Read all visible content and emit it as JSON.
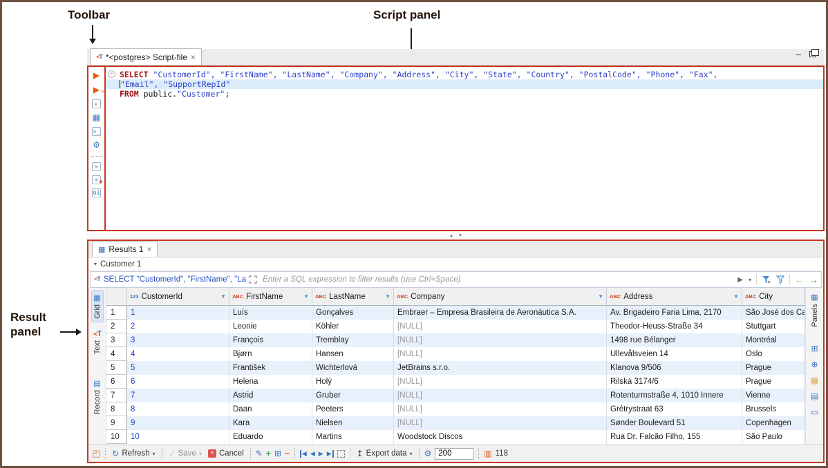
{
  "annotations": {
    "toolbar": "Toolbar",
    "script_panel": "Script panel",
    "result_panel": "Result panel"
  },
  "icons": {
    "caret_down": "▾",
    "sort_down": "▼",
    "refresh": "↻",
    "save_check": "✓",
    "cancel_x": "×",
    "export_up": "↥",
    "gear": "⚙",
    "nav_prev": "◀",
    "nav_next": "▶",
    "grid_tab": "▦",
    "record_tab": "▤",
    "panels_tab": "▦",
    "results_tab": "▦",
    "breadcrumb_caret": "▾",
    "filter_play": "▶",
    "hist_back": "←",
    "hist_fwd": "→",
    "edit_cell": "✎",
    "add_row": "+",
    "dup_row": "⊞",
    "del_row": "−",
    "row_count_glyph": "▥",
    "presentation": "◰",
    "minimize": "–",
    "sash_up": "▲",
    "sash_down": "▼",
    "fold": "−"
  },
  "editor": {
    "tab_title": "*<postgres> Script-file",
    "close": "×",
    "fold_marker": "−",
    "lines": [
      {
        "highlight": false,
        "cursor": false,
        "tokens": [
          {
            "c": "kw",
            "t": "SELECT"
          },
          {
            "c": "pl",
            "t": " "
          },
          {
            "c": "id",
            "t": "\"CustomerId\", \"FirstName\", \"LastName\", \"Company\", \"Address\", \"City\", \"State\", \"Country\", \"PostalCode\", \"Phone\", \"Fax\","
          }
        ]
      },
      {
        "highlight": true,
        "cursor": true,
        "tokens": [
          {
            "c": "id",
            "t": "\"Email\", \"SupportRepId\""
          }
        ]
      },
      {
        "highlight": false,
        "cursor": false,
        "tokens": [
          {
            "c": "kw",
            "t": "FROM"
          },
          {
            "c": "pl",
            "t": " public."
          },
          {
            "c": "id",
            "t": "\"Customer\""
          },
          {
            "c": "pl",
            "t": ";"
          }
        ]
      }
    ],
    "toolbar_icons": [
      {
        "name": "execute-statement-icon",
        "glyph": "▶",
        "color": "#e8590c"
      },
      {
        "name": "execute-script-icon",
        "glyph": "▶",
        "color": "#e8590c",
        "badge": "≡",
        "badge_color": "#e8590c"
      },
      {
        "name": "execute-new-tab-icon",
        "glyph": "▸",
        "color": "#e8590c",
        "boxed": true
      },
      {
        "name": "explain-plan-icon",
        "glyph": "▦",
        "color": "#3b76c0"
      },
      {
        "name": "sql-console-icon",
        "glyph": ">_",
        "color": "#3b76c0",
        "boxed": true
      },
      {
        "name": "settings-gear-icon",
        "glyph": "⚙",
        "color": "#3b76c0"
      },
      {
        "sep": true
      },
      {
        "name": "new-script-icon",
        "glyph": "≡",
        "color": "#7a96b8",
        "boxed": true
      },
      {
        "name": "delete-script-icon",
        "glyph": "≡",
        "color": "#7a96b8",
        "boxed": true,
        "badge": "●",
        "badge_color": "#d9534f"
      },
      {
        "name": "binary-data-icon",
        "glyph": "01",
        "color": "#3b76c0",
        "boxed": true
      }
    ]
  },
  "results": {
    "tab_title": "Results 1",
    "tab_close": "×",
    "breadcrumb": "Customer 1",
    "filter": {
      "sql_snippet": "SELECT \"CustomerId\", \"FirstName\", \"La",
      "placeholder": "Enter a SQL expression to filter results (use Ctrl+Space)"
    },
    "side_tabs": {
      "grid": "Grid",
      "text": "Text",
      "record": "Record",
      "panels": "Panels"
    },
    "panel_icons": [
      {
        "name": "grouping-panel-icon",
        "glyph": "⊞",
        "color": "#3b76c0"
      },
      {
        "name": "value-viewer-icon",
        "glyph": "⊕",
        "color": "#3b76c0"
      },
      {
        "name": "calc-panel-icon",
        "glyph": "▦",
        "color": "#e8a13c"
      },
      {
        "name": "metadata-panel-icon",
        "glyph": "▤",
        "color": "#3b76c0"
      },
      {
        "name": "references-panel-icon",
        "glyph": "▭",
        "color": "#3b76c0"
      }
    ],
    "table": {
      "columns": [
        {
          "name": "CustomerId",
          "type_icon": "123",
          "kind": "number",
          "caret": true
        },
        {
          "name": "FirstName",
          "type_icon": "ABC",
          "kind": "string",
          "caret": true
        },
        {
          "name": "LastName",
          "type_icon": "ABC",
          "kind": "string",
          "caret": true
        },
        {
          "name": "Company",
          "type_icon": "ABC",
          "kind": "string",
          "caret": true
        },
        {
          "name": "Address",
          "type_icon": "ABC",
          "kind": "string",
          "caret": true
        },
        {
          "name": "City",
          "type_icon": "ABC",
          "kind": "string",
          "caret": false
        }
      ],
      "rows": [
        {
          "num": "1",
          "cells": [
            "1",
            "Luís",
            "Gonçalves",
            "Embraer – Empresa Brasileira de Aeronáutica S.A.",
            "Av. Brigadeiro Faria Lima, 2170",
            "São José dos Campos"
          ]
        },
        {
          "num": "2",
          "cells": [
            "2",
            "Leonie",
            "Köhler",
            "[NULL]",
            "Theodor-Heuss-Straße 34",
            "Stuttgart"
          ]
        },
        {
          "num": "3",
          "cells": [
            "3",
            "François",
            "Tremblay",
            "[NULL]",
            "1498 rue Bélanger",
            "Montréal"
          ]
        },
        {
          "num": "4",
          "cells": [
            "4",
            "Bjørn",
            "Hansen",
            "[NULL]",
            "Ullevålsveien 14",
            "Oslo"
          ]
        },
        {
          "num": "5",
          "cells": [
            "5",
            "František",
            "Wichterlová",
            "JetBrains s.r.o.",
            "Klanova 9/506",
            "Prague"
          ]
        },
        {
          "num": "6",
          "cells": [
            "6",
            "Helena",
            "Holý",
            "[NULL]",
            "Rilská 3174/6",
            "Prague"
          ]
        },
        {
          "num": "7",
          "cells": [
            "7",
            "Astrid",
            "Gruber",
            "[NULL]",
            "Rotenturmstraße 4, 1010 Innere",
            "Vienne"
          ]
        },
        {
          "num": "8",
          "cells": [
            "8",
            "Daan",
            "Peeters",
            "[NULL]",
            "Grétrystraat 63",
            "Brussels"
          ]
        },
        {
          "num": "9",
          "cells": [
            "9",
            "Kara",
            "Nielsen",
            "[NULL]",
            "Sønder Boulevard 51",
            "Copenhagen"
          ]
        },
        {
          "num": "10",
          "cells": [
            "10",
            "Eduardo",
            "Martins",
            "Woodstock Discos",
            "Rua Dr. Falcão Filho, 155",
            "São Paulo"
          ]
        }
      ]
    },
    "statusbar": {
      "refresh": "Refresh",
      "save": "Save",
      "cancel": "Cancel",
      "export": "Export data",
      "fetch_size": "200",
      "row_count": "118"
    }
  }
}
